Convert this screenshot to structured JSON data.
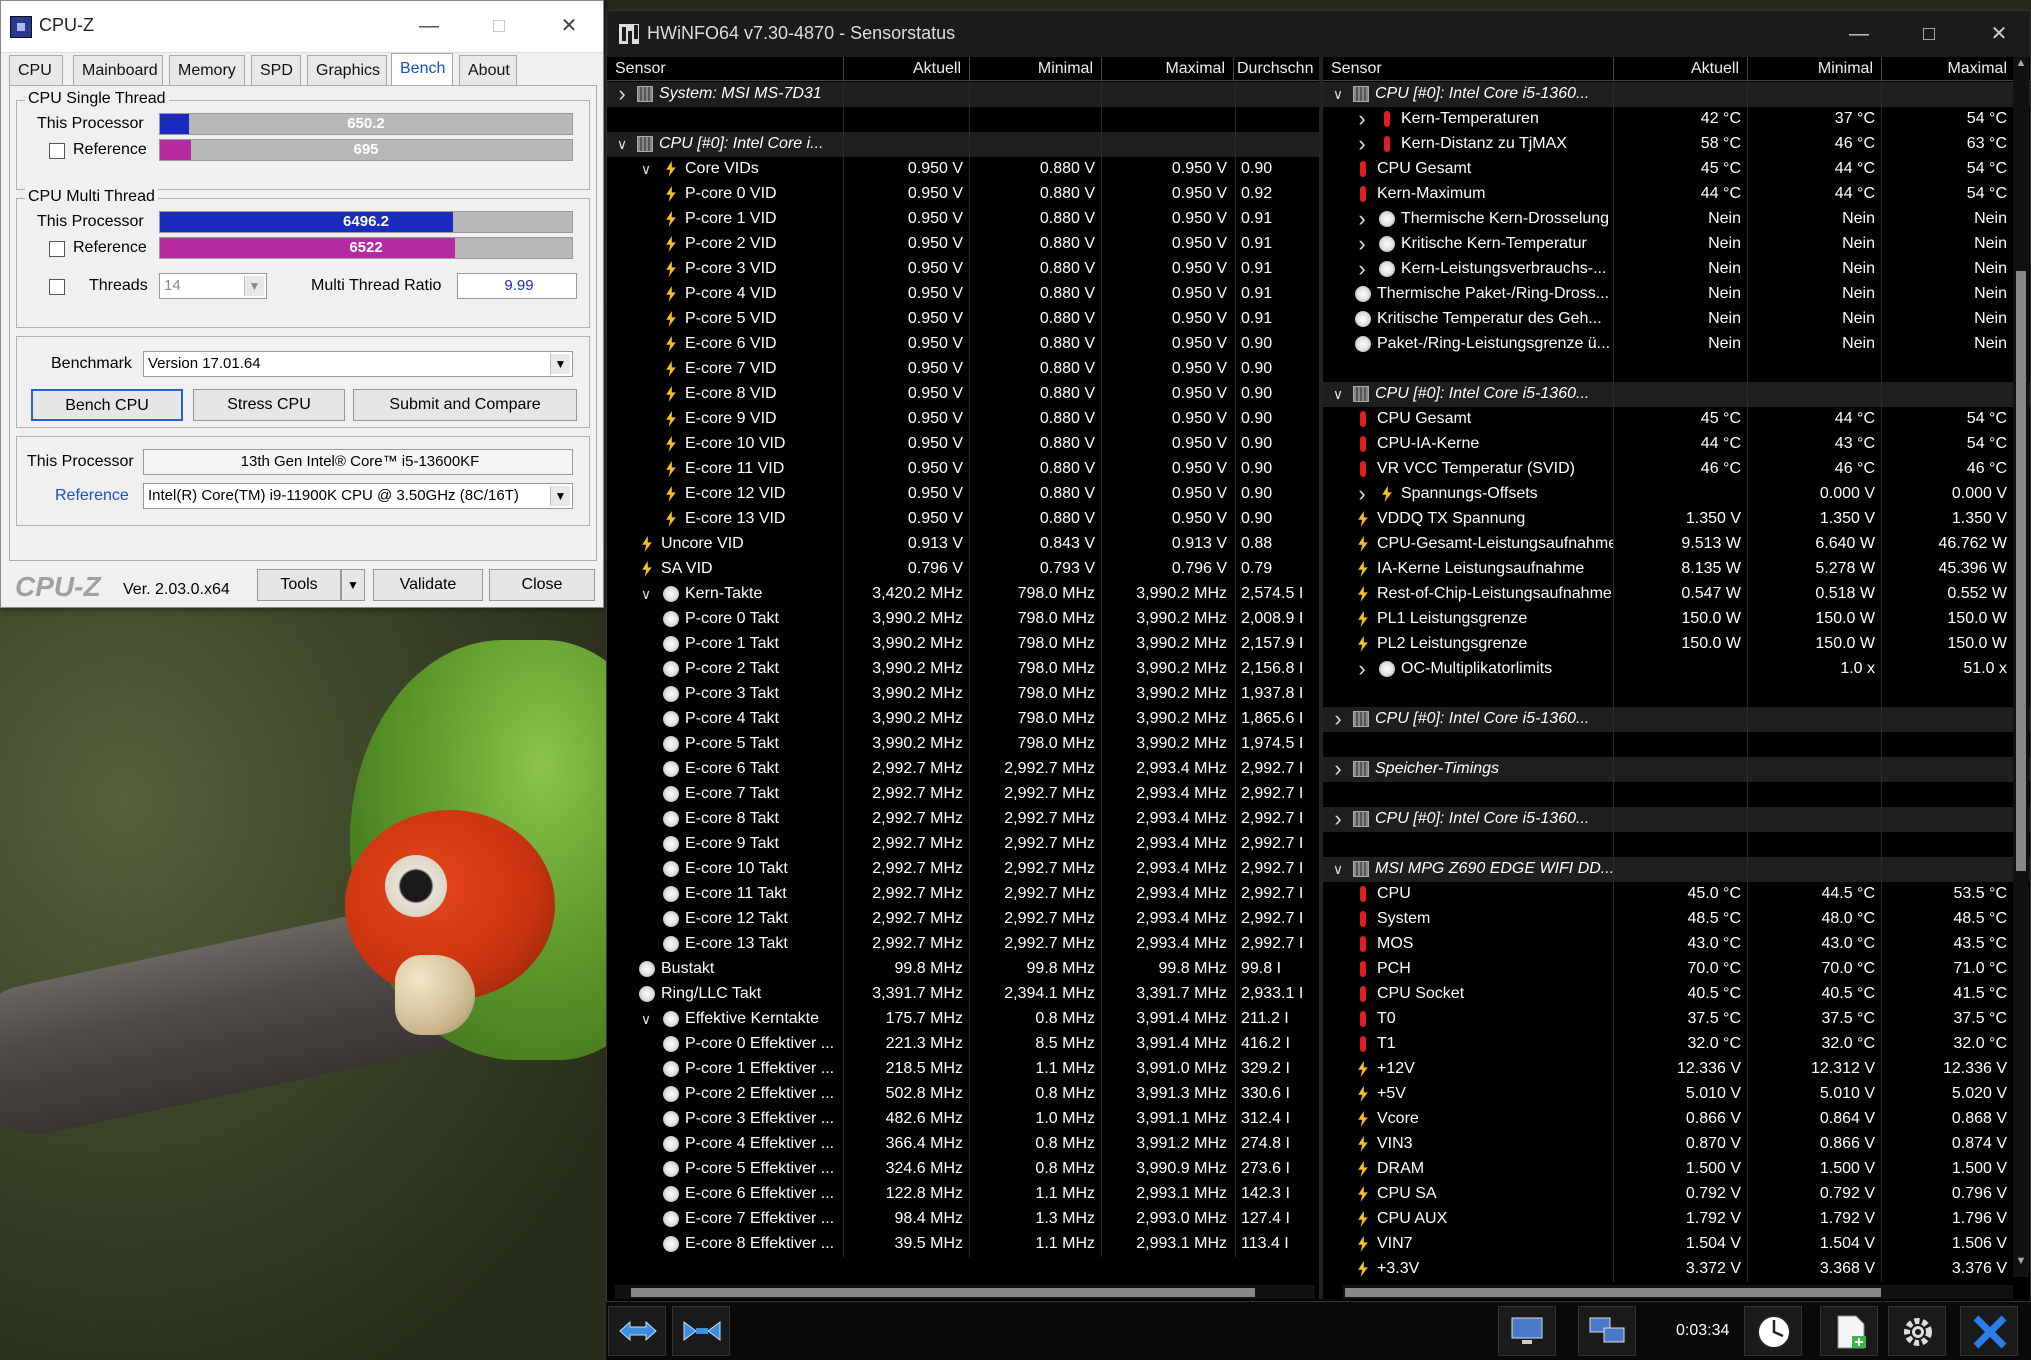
{
  "cpuz": {
    "title": "CPU-Z",
    "tabs": [
      "CPU",
      "Mainboard",
      "Memory",
      "SPD",
      "Graphics",
      "Bench",
      "About"
    ],
    "active_tab": "Bench",
    "single": {
      "title": "CPU Single Thread",
      "this_label": "This Processor",
      "this_value": "650.2",
      "this_fraction": 0.07,
      "ref_label": "Reference",
      "ref_value": "695",
      "ref_fraction": 0.075
    },
    "multi": {
      "title": "CPU Multi Thread",
      "this_label": "This Processor",
      "this_value": "6496.2",
      "this_fraction": 0.71,
      "ref_label": "Reference",
      "ref_value": "6522",
      "ref_fraction": 0.715,
      "threads_label": "Threads",
      "threads_value": "14",
      "ratio_label": "Multi Thread Ratio",
      "ratio_value": "9.99"
    },
    "benchmark": {
      "label": "Benchmark",
      "version": "Version 17.01.64",
      "bench_cpu": "Bench CPU",
      "stress_cpu": "Stress CPU",
      "submit": "Submit and Compare"
    },
    "proc": {
      "this_label": "This Processor",
      "this_value": "13th Gen Intel® Core™ i5-13600KF",
      "ref_label": "Reference",
      "ref_value": "Intel(R) Core(TM) i9-11900K CPU @ 3.50GHz (8C/16T)"
    },
    "footer": {
      "logo": "CPU-Z",
      "version": "Ver. 2.03.0.x64",
      "tools": "Tools",
      "validate": "Validate",
      "close": "Close"
    },
    "colors": {
      "this_bar": "#1a2cc0",
      "ref_bar": "#b52aa0"
    }
  },
  "hwinfo": {
    "title": "HWiNFO64 v7.30-4870 - Sensorstatus",
    "left_headers": [
      "Sensor",
      "Aktuell",
      "Minimal",
      "Maximal",
      "Durchschn"
    ],
    "right_headers": [
      "Sensor",
      "Aktuell",
      "Minimal",
      "Maximal"
    ],
    "left_rows": [
      {
        "t": "g",
        "n": "System: MSI MS-7D31",
        "c": ">"
      },
      {
        "t": "b"
      },
      {
        "t": "g",
        "n": "CPU [#0]: Intel Core i...",
        "c": "v"
      },
      {
        "t": "s",
        "i": "volt",
        "d": 1,
        "c": "v",
        "n": "Core VIDs",
        "v": [
          "0.950 V",
          "0.880 V",
          "0.950 V",
          "0.90"
        ]
      },
      {
        "t": "s",
        "i": "volt",
        "d": 1,
        "n": "P-core 0 VID",
        "v": [
          "0.950 V",
          "0.880 V",
          "0.950 V",
          "0.92"
        ]
      },
      {
        "t": "s",
        "i": "volt",
        "d": 1,
        "n": "P-core 1 VID",
        "v": [
          "0.950 V",
          "0.880 V",
          "0.950 V",
          "0.91"
        ]
      },
      {
        "t": "s",
        "i": "volt",
        "d": 1,
        "n": "P-core 2 VID",
        "v": [
          "0.950 V",
          "0.880 V",
          "0.950 V",
          "0.91"
        ]
      },
      {
        "t": "s",
        "i": "volt",
        "d": 1,
        "n": "P-core 3 VID",
        "v": [
          "0.950 V",
          "0.880 V",
          "0.950 V",
          "0.91"
        ]
      },
      {
        "t": "s",
        "i": "volt",
        "d": 1,
        "n": "P-core 4 VID",
        "v": [
          "0.950 V",
          "0.880 V",
          "0.950 V",
          "0.91"
        ]
      },
      {
        "t": "s",
        "i": "volt",
        "d": 1,
        "n": "P-core 5 VID",
        "v": [
          "0.950 V",
          "0.880 V",
          "0.950 V",
          "0.91"
        ]
      },
      {
        "t": "s",
        "i": "volt",
        "d": 1,
        "n": "E-core 6 VID",
        "v": [
          "0.950 V",
          "0.880 V",
          "0.950 V",
          "0.90"
        ]
      },
      {
        "t": "s",
        "i": "volt",
        "d": 1,
        "n": "E-core 7 VID",
        "v": [
          "0.950 V",
          "0.880 V",
          "0.950 V",
          "0.90"
        ]
      },
      {
        "t": "s",
        "i": "volt",
        "d": 1,
        "n": "E-core 8 VID",
        "v": [
          "0.950 V",
          "0.880 V",
          "0.950 V",
          "0.90"
        ]
      },
      {
        "t": "s",
        "i": "volt",
        "d": 1,
        "n": "E-core 9 VID",
        "v": [
          "0.950 V",
          "0.880 V",
          "0.950 V",
          "0.90"
        ]
      },
      {
        "t": "s",
        "i": "volt",
        "d": 1,
        "n": "E-core 10 VID",
        "v": [
          "0.950 V",
          "0.880 V",
          "0.950 V",
          "0.90"
        ]
      },
      {
        "t": "s",
        "i": "volt",
        "d": 1,
        "n": "E-core 11 VID",
        "v": [
          "0.950 V",
          "0.880 V",
          "0.950 V",
          "0.90"
        ]
      },
      {
        "t": "s",
        "i": "volt",
        "d": 1,
        "n": "E-core 12 VID",
        "v": [
          "0.950 V",
          "0.880 V",
          "0.950 V",
          "0.90"
        ]
      },
      {
        "t": "s",
        "i": "volt",
        "d": 1,
        "n": "E-core 13 VID",
        "v": [
          "0.950 V",
          "0.880 V",
          "0.950 V",
          "0.90"
        ]
      },
      {
        "t": "s",
        "i": "volt",
        "d": 0,
        "n": "Uncore VID",
        "v": [
          "0.913 V",
          "0.843 V",
          "0.913 V",
          "0.88"
        ]
      },
      {
        "t": "s",
        "i": "volt",
        "d": 0,
        "n": "SA VID",
        "v": [
          "0.796 V",
          "0.793 V",
          "0.796 V",
          "0.79"
        ]
      },
      {
        "t": "s",
        "i": "clock",
        "d": 1,
        "c": "v",
        "n": "Kern-Takte",
        "v": [
          "3,420.2 MHz",
          "798.0 MHz",
          "3,990.2 MHz",
          "2,574.5 I"
        ]
      },
      {
        "t": "s",
        "i": "clock",
        "d": 1,
        "n": "P-core 0 Takt",
        "v": [
          "3,990.2 MHz",
          "798.0 MHz",
          "3,990.2 MHz",
          "2,008.9 I"
        ]
      },
      {
        "t": "s",
        "i": "clock",
        "d": 1,
        "n": "P-core 1 Takt",
        "v": [
          "3,990.2 MHz",
          "798.0 MHz",
          "3,990.2 MHz",
          "2,157.9 I"
        ]
      },
      {
        "t": "s",
        "i": "clock",
        "d": 1,
        "n": "P-core 2 Takt",
        "v": [
          "3,990.2 MHz",
          "798.0 MHz",
          "3,990.2 MHz",
          "2,156.8 I"
        ]
      },
      {
        "t": "s",
        "i": "clock",
        "d": 1,
        "n": "P-core 3 Takt",
        "v": [
          "3,990.2 MHz",
          "798.0 MHz",
          "3,990.2 MHz",
          "1,937.8 I"
        ]
      },
      {
        "t": "s",
        "i": "clock",
        "d": 1,
        "n": "P-core 4 Takt",
        "v": [
          "3,990.2 MHz",
          "798.0 MHz",
          "3,990.2 MHz",
          "1,865.6 I"
        ]
      },
      {
        "t": "s",
        "i": "clock",
        "d": 1,
        "n": "P-core 5 Takt",
        "v": [
          "3,990.2 MHz",
          "798.0 MHz",
          "3,990.2 MHz",
          "1,974.5 I"
        ]
      },
      {
        "t": "s",
        "i": "clock",
        "d": 1,
        "n": "E-core 6 Takt",
        "v": [
          "2,992.7 MHz",
          "2,992.7 MHz",
          "2,993.4 MHz",
          "2,992.7 I"
        ]
      },
      {
        "t": "s",
        "i": "clock",
        "d": 1,
        "n": "E-core 7 Takt",
        "v": [
          "2,992.7 MHz",
          "2,992.7 MHz",
          "2,993.4 MHz",
          "2,992.7 I"
        ]
      },
      {
        "t": "s",
        "i": "clock",
        "d": 1,
        "n": "E-core 8 Takt",
        "v": [
          "2,992.7 MHz",
          "2,992.7 MHz",
          "2,993.4 MHz",
          "2,992.7 I"
        ]
      },
      {
        "t": "s",
        "i": "clock",
        "d": 1,
        "n": "E-core 9 Takt",
        "v": [
          "2,992.7 MHz",
          "2,992.7 MHz",
          "2,993.4 MHz",
          "2,992.7 I"
        ]
      },
      {
        "t": "s",
        "i": "clock",
        "d": 1,
        "n": "E-core 10 Takt",
        "v": [
          "2,992.7 MHz",
          "2,992.7 MHz",
          "2,993.4 MHz",
          "2,992.7 I"
        ]
      },
      {
        "t": "s",
        "i": "clock",
        "d": 1,
        "n": "E-core 11 Takt",
        "v": [
          "2,992.7 MHz",
          "2,992.7 MHz",
          "2,993.4 MHz",
          "2,992.7 I"
        ]
      },
      {
        "t": "s",
        "i": "clock",
        "d": 1,
        "n": "E-core 12 Takt",
        "v": [
          "2,992.7 MHz",
          "2,992.7 MHz",
          "2,993.4 MHz",
          "2,992.7 I"
        ]
      },
      {
        "t": "s",
        "i": "clock",
        "d": 1,
        "n": "E-core 13 Takt",
        "v": [
          "2,992.7 MHz",
          "2,992.7 MHz",
          "2,993.4 MHz",
          "2,992.7 I"
        ]
      },
      {
        "t": "s",
        "i": "clock",
        "d": 0,
        "n": "Bustakt",
        "v": [
          "99.8 MHz",
          "99.8 MHz",
          "99.8 MHz",
          "99.8 I"
        ]
      },
      {
        "t": "s",
        "i": "clock",
        "d": 0,
        "n": "Ring/LLC Takt",
        "v": [
          "3,391.7 MHz",
          "2,394.1 MHz",
          "3,391.7 MHz",
          "2,933.1 I"
        ]
      },
      {
        "t": "s",
        "i": "clock",
        "d": 1,
        "c": "v",
        "n": "Effektive Kerntakte",
        "v": [
          "175.7 MHz",
          "0.8 MHz",
          "3,991.4 MHz",
          "211.2 I"
        ]
      },
      {
        "t": "s",
        "i": "clock",
        "d": 1,
        "n": "P-core 0 Effektiver ...",
        "v": [
          "221.3 MHz",
          "8.5 MHz",
          "3,991.4 MHz",
          "416.2 I"
        ]
      },
      {
        "t": "s",
        "i": "clock",
        "d": 1,
        "n": "P-core 1 Effektiver ...",
        "v": [
          "218.5 MHz",
          "1.1 MHz",
          "3,991.0 MHz",
          "329.2 I"
        ]
      },
      {
        "t": "s",
        "i": "clock",
        "d": 1,
        "n": "P-core 2 Effektiver ...",
        "v": [
          "502.8 MHz",
          "0.8 MHz",
          "3,991.3 MHz",
          "330.6 I"
        ]
      },
      {
        "t": "s",
        "i": "clock",
        "d": 1,
        "n": "P-core 3 Effektiver ...",
        "v": [
          "482.6 MHz",
          "1.0 MHz",
          "3,991.1 MHz",
          "312.4 I"
        ]
      },
      {
        "t": "s",
        "i": "clock",
        "d": 1,
        "n": "P-core 4 Effektiver ...",
        "v": [
          "366.4 MHz",
          "0.8 MHz",
          "3,991.2 MHz",
          "274.8 I"
        ]
      },
      {
        "t": "s",
        "i": "clock",
        "d": 1,
        "n": "P-core 5 Effektiver ...",
        "v": [
          "324.6 MHz",
          "0.8 MHz",
          "3,990.9 MHz",
          "273.6 I"
        ]
      },
      {
        "t": "s",
        "i": "clock",
        "d": 1,
        "n": "E-core 6 Effektiver ...",
        "v": [
          "122.8 MHz",
          "1.1 MHz",
          "2,993.1 MHz",
          "142.3 I"
        ]
      },
      {
        "t": "s",
        "i": "clock",
        "d": 1,
        "n": "E-core 7 Effektiver ...",
        "v": [
          "98.4 MHz",
          "1.3 MHz",
          "2,993.0 MHz",
          "127.4 I"
        ]
      },
      {
        "t": "s",
        "i": "clock",
        "d": 1,
        "n": "E-core 8 Effektiver ...",
        "v": [
          "39.5 MHz",
          "1.1 MHz",
          "2,993.1 MHz",
          "113.4 I"
        ]
      }
    ],
    "right_rows": [
      {
        "t": "g",
        "n": "CPU [#0]: Intel Core i5-1360...",
        "c": "v"
      },
      {
        "t": "s",
        "i": "temp",
        "d": 1,
        "c": ">",
        "n": "Kern-Temperaturen",
        "v": [
          "42 °C",
          "37 °C",
          "54 °C"
        ]
      },
      {
        "t": "s",
        "i": "temp",
        "d": 1,
        "c": ">",
        "n": "Kern-Distanz zu TjMAX",
        "v": [
          "58 °C",
          "46 °C",
          "63 °C"
        ]
      },
      {
        "t": "s",
        "i": "temp",
        "d": 0,
        "n": "CPU Gesamt",
        "v": [
          "45 °C",
          "44 °C",
          "54 °C"
        ]
      },
      {
        "t": "s",
        "i": "temp",
        "d": 0,
        "n": "Kern-Maximum",
        "v": [
          "44 °C",
          "44 °C",
          "54 °C"
        ]
      },
      {
        "t": "s",
        "i": "clock",
        "d": 1,
        "c": ">",
        "n": "Thermische Kern-Drosselung",
        "v": [
          "Nein",
          "Nein",
          "Nein"
        ]
      },
      {
        "t": "s",
        "i": "clock",
        "d": 1,
        "c": ">",
        "n": "Kritische Kern-Temperatur",
        "v": [
          "Nein",
          "Nein",
          "Nein"
        ]
      },
      {
        "t": "s",
        "i": "clock",
        "d": 1,
        "c": ">",
        "n": "Kern-Leistungsverbrauchs-...",
        "v": [
          "Nein",
          "Nein",
          "Nein"
        ]
      },
      {
        "t": "s",
        "i": "clock",
        "d": 0,
        "n": "Thermische Paket-/Ring-Dross...",
        "v": [
          "Nein",
          "Nein",
          "Nein"
        ]
      },
      {
        "t": "s",
        "i": "clock",
        "d": 0,
        "n": "Kritische Temperatur des Geh...",
        "v": [
          "Nein",
          "Nein",
          "Nein"
        ]
      },
      {
        "t": "s",
        "i": "clock",
        "d": 0,
        "n": "Paket-/Ring-Leistungsgrenze ü...",
        "v": [
          "Nein",
          "Nein",
          "Nein"
        ]
      },
      {
        "t": "b"
      },
      {
        "t": "g",
        "n": "CPU [#0]: Intel Core i5-1360...",
        "c": "v"
      },
      {
        "t": "s",
        "i": "temp",
        "d": 0,
        "n": "CPU Gesamt",
        "v": [
          "45 °C",
          "44 °C",
          "54 °C"
        ]
      },
      {
        "t": "s",
        "i": "temp",
        "d": 0,
        "n": "CPU-IA-Kerne",
        "v": [
          "44 °C",
          "43 °C",
          "54 °C"
        ]
      },
      {
        "t": "s",
        "i": "temp",
        "d": 0,
        "n": "VR VCC Temperatur (SVID)",
        "v": [
          "46 °C",
          "46 °C",
          "46 °C"
        ]
      },
      {
        "t": "s",
        "i": "volt",
        "d": 1,
        "c": ">",
        "n": "Spannungs-Offsets",
        "v": [
          "",
          "0.000 V",
          "0.000 V"
        ]
      },
      {
        "t": "s",
        "i": "volt",
        "d": 0,
        "n": "VDDQ TX Spannung",
        "v": [
          "1.350 V",
          "1.350 V",
          "1.350 V"
        ]
      },
      {
        "t": "s",
        "i": "power",
        "d": 0,
        "n": "CPU-Gesamt-Leistungsaufnahme",
        "v": [
          "9.513 W",
          "6.640 W",
          "46.762 W"
        ]
      },
      {
        "t": "s",
        "i": "power",
        "d": 0,
        "n": "IA-Kerne Leistungsaufnahme",
        "v": [
          "8.135 W",
          "5.278 W",
          "45.396 W"
        ]
      },
      {
        "t": "s",
        "i": "power",
        "d": 0,
        "n": "Rest-of-Chip-Leistungsaufnahme",
        "v": [
          "0.547 W",
          "0.518 W",
          "0.552 W"
        ]
      },
      {
        "t": "s",
        "i": "power",
        "d": 0,
        "n": "PL1 Leistungsgrenze",
        "v": [
          "150.0 W",
          "150.0 W",
          "150.0 W"
        ]
      },
      {
        "t": "s",
        "i": "power",
        "d": 0,
        "n": "PL2 Leistungsgrenze",
        "v": [
          "150.0 W",
          "150.0 W",
          "150.0 W"
        ]
      },
      {
        "t": "s",
        "i": "clock",
        "d": 1,
        "c": ">",
        "n": "OC-Multiplikatorlimits",
        "v": [
          "",
          "1.0 x",
          "51.0 x"
        ]
      },
      {
        "t": "b"
      },
      {
        "t": "g",
        "n": "CPU [#0]: Intel Core i5-1360...",
        "c": ">"
      },
      {
        "t": "b"
      },
      {
        "t": "g",
        "n": "Speicher-Timings",
        "c": ">"
      },
      {
        "t": "b"
      },
      {
        "t": "g",
        "n": "CPU [#0]: Intel Core i5-1360...",
        "c": ">"
      },
      {
        "t": "b"
      },
      {
        "t": "g",
        "n": "MSI MPG Z690 EDGE WIFI DD...",
        "c": "v"
      },
      {
        "t": "s",
        "i": "temp",
        "d": 0,
        "n": "CPU",
        "v": [
          "45.0 °C",
          "44.5 °C",
          "53.5 °C"
        ]
      },
      {
        "t": "s",
        "i": "temp",
        "d": 0,
        "n": "System",
        "v": [
          "48.5 °C",
          "48.0 °C",
          "48.5 °C"
        ]
      },
      {
        "t": "s",
        "i": "temp",
        "d": 0,
        "n": "MOS",
        "v": [
          "43.0 °C",
          "43.0 °C",
          "43.5 °C"
        ]
      },
      {
        "t": "s",
        "i": "temp",
        "d": 0,
        "n": "PCH",
        "v": [
          "70.0 °C",
          "70.0 °C",
          "71.0 °C"
        ]
      },
      {
        "t": "s",
        "i": "temp",
        "d": 0,
        "n": "CPU Socket",
        "v": [
          "40.5 °C",
          "40.5 °C",
          "41.5 °C"
        ]
      },
      {
        "t": "s",
        "i": "temp",
        "d": 0,
        "n": "T0",
        "v": [
          "37.5 °C",
          "37.5 °C",
          "37.5 °C"
        ]
      },
      {
        "t": "s",
        "i": "temp",
        "d": 0,
        "n": "T1",
        "v": [
          "32.0 °C",
          "32.0 °C",
          "32.0 °C"
        ]
      },
      {
        "t": "s",
        "i": "volt",
        "d": 0,
        "n": "+12V",
        "v": [
          "12.336 V",
          "12.312 V",
          "12.336 V"
        ]
      },
      {
        "t": "s",
        "i": "volt",
        "d": 0,
        "n": "+5V",
        "v": [
          "5.010 V",
          "5.010 V",
          "5.020 V"
        ]
      },
      {
        "t": "s",
        "i": "volt",
        "d": 0,
        "n": "Vcore",
        "v": [
          "0.866 V",
          "0.864 V",
          "0.868 V"
        ]
      },
      {
        "t": "s",
        "i": "volt",
        "d": 0,
        "n": "VIN3",
        "v": [
          "0.870 V",
          "0.866 V",
          "0.874 V"
        ]
      },
      {
        "t": "s",
        "i": "volt",
        "d": 0,
        "n": "DRAM",
        "v": [
          "1.500 V",
          "1.500 V",
          "1.500 V"
        ]
      },
      {
        "t": "s",
        "i": "volt",
        "d": 0,
        "n": "CPU SA",
        "v": [
          "0.792 V",
          "0.792 V",
          "0.796 V"
        ]
      },
      {
        "t": "s",
        "i": "volt",
        "d": 0,
        "n": "CPU AUX",
        "v": [
          "1.792 V",
          "1.792 V",
          "1.796 V"
        ]
      },
      {
        "t": "s",
        "i": "volt",
        "d": 0,
        "n": "VIN7",
        "v": [
          "1.504 V",
          "1.504 V",
          "1.506 V"
        ]
      },
      {
        "t": "s",
        "i": "volt",
        "d": 0,
        "n": "+3.3V",
        "v": [
          "3.372 V",
          "3.368 V",
          "3.376 V"
        ]
      }
    ],
    "timer": "0:03:34"
  }
}
